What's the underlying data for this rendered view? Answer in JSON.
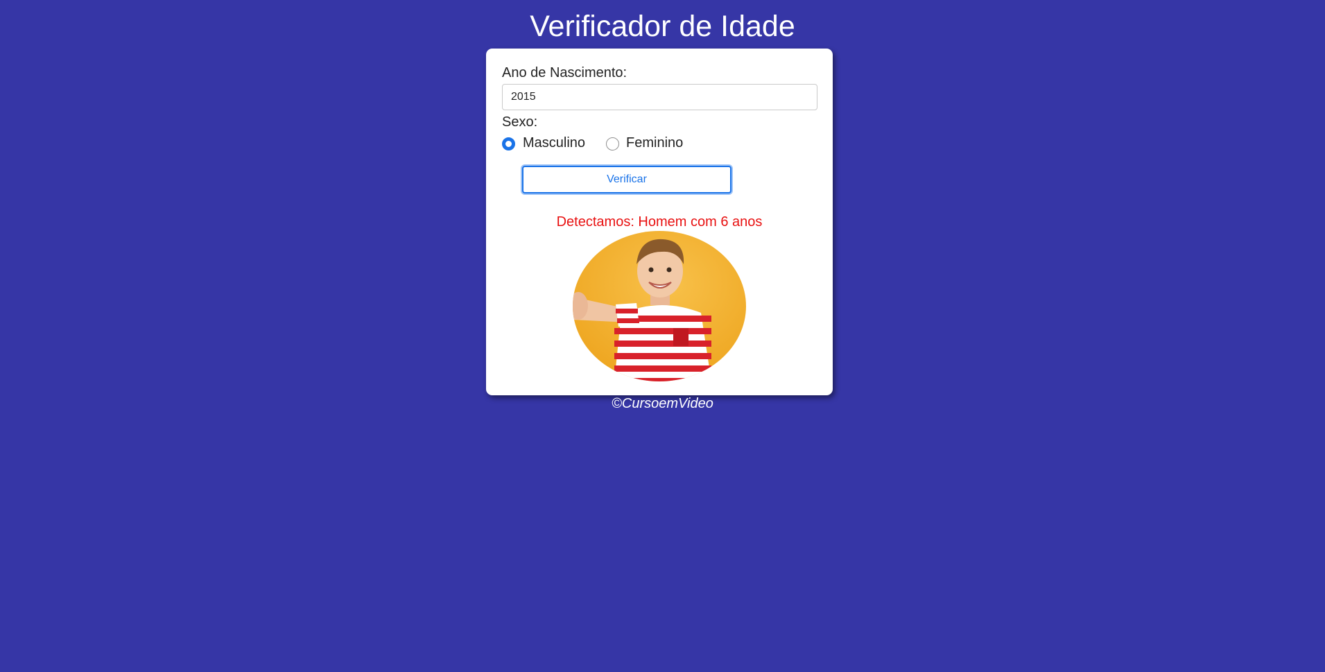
{
  "header": {
    "title": "Verificador de Idade"
  },
  "form": {
    "year_label": "Ano de Nascimento:",
    "year_value": "2015",
    "sex_label": "Sexo:",
    "sex_options": [
      {
        "label": "Masculino",
        "checked": true
      },
      {
        "label": "Feminino",
        "checked": false
      }
    ],
    "verify_label": "Verificar"
  },
  "result": {
    "text": "Detectamos: Homem com 6 anos",
    "color": "#e81010",
    "image": "boy-thumbs-up"
  },
  "footer": {
    "text": "©CursoemVideo"
  },
  "colors": {
    "background": "#3636a6",
    "accent": "#1a73e8",
    "card": "#ffffff"
  }
}
